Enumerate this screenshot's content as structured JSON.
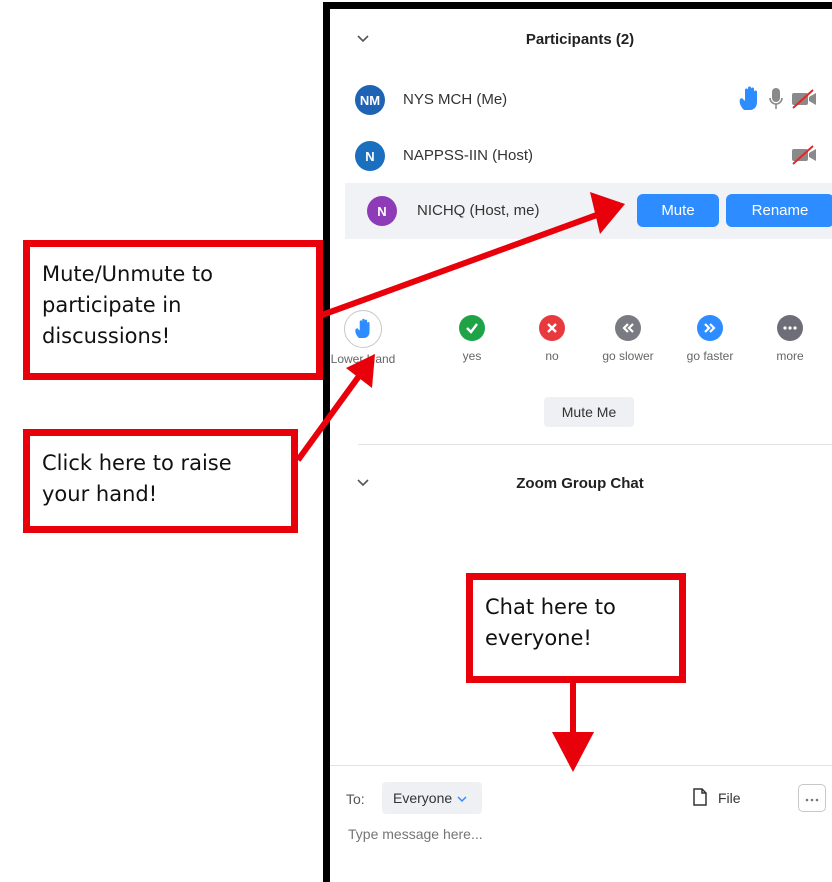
{
  "participants": {
    "title": "Participants (2)",
    "rows": [
      {
        "initials": "NM",
        "name": "NYS MCH (Me)",
        "avatar_color": "#1f64b4"
      },
      {
        "initials": "N",
        "name": "NAPPSS-IIN (Host)",
        "avatar_color": "#1a6fbf"
      },
      {
        "initials": "N",
        "name": "NICHQ (Host, me)",
        "avatar_color": "#8e3bb7"
      }
    ],
    "mute_label": "Mute",
    "rename_label": "Rename"
  },
  "reactions": [
    {
      "label": "Lower Hand",
      "icon": "raised-hand-icon",
      "color": "#2d8cff"
    },
    {
      "label": "yes",
      "icon": "check-icon",
      "color": "#1ea446"
    },
    {
      "label": "no",
      "icon": "x-icon",
      "color": "#e8393f"
    },
    {
      "label": "go slower",
      "icon": "rewind-icon",
      "color": "#7a7a82"
    },
    {
      "label": "go faster",
      "icon": "fast-forward-icon",
      "color": "#2d8cff"
    },
    {
      "label": "more",
      "icon": "ellipsis-icon",
      "color": "#6e6e78"
    }
  ],
  "mute_me_label": "Mute Me",
  "chat": {
    "title": "Zoom Group Chat",
    "to_label": "To:",
    "recipient": "Everyone",
    "file_label": "File",
    "placeholder": "Type message here..."
  },
  "callouts": {
    "mute": "Mute/Unmute to participate in discussions!",
    "hand": "Click here to raise your hand!",
    "chat": "Chat here to everyone!"
  },
  "colors": {
    "accent": "#2d8cff",
    "callout_red": "#e8000b"
  }
}
